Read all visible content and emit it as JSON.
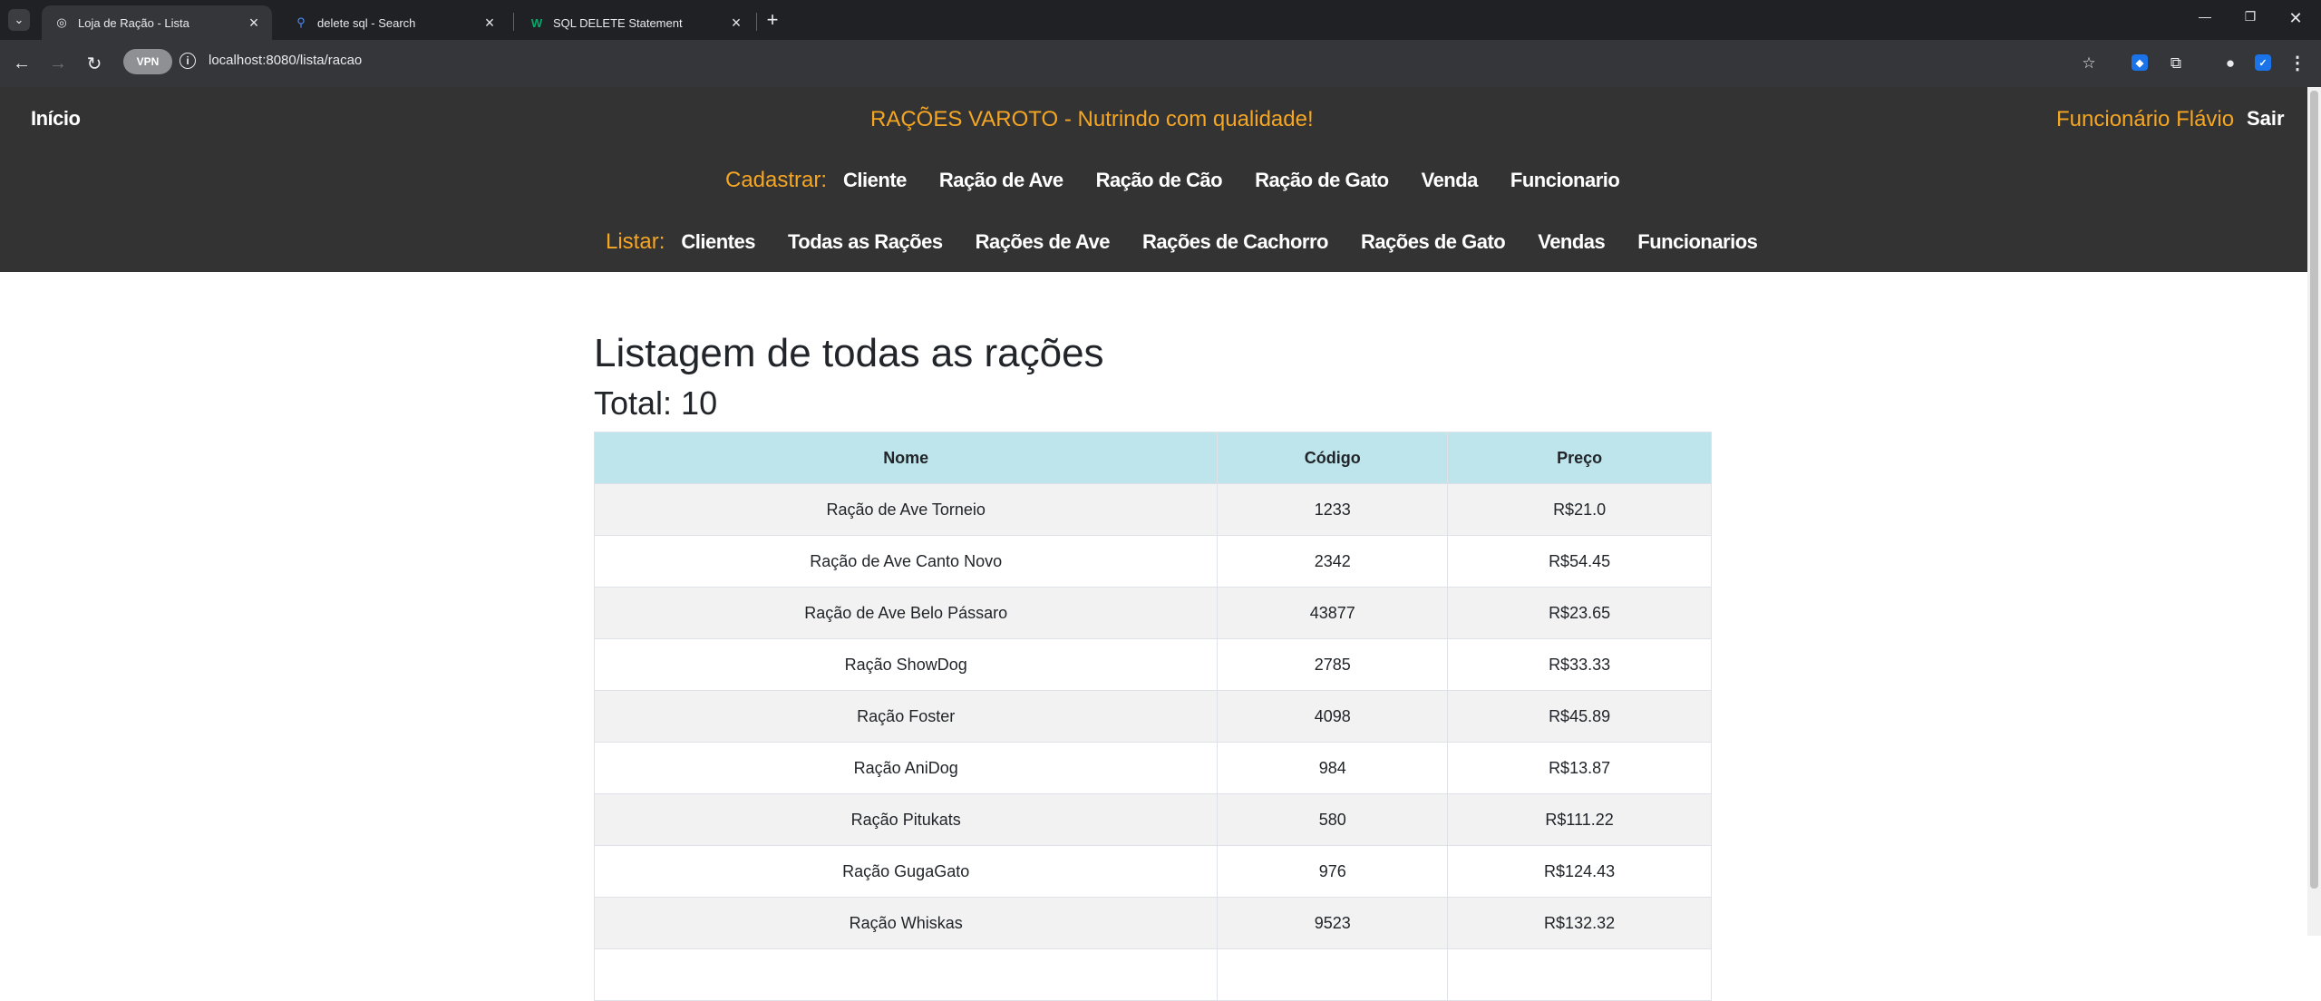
{
  "browser": {
    "tabs": [
      {
        "title": "Loja de Ração - Lista",
        "active": true
      },
      {
        "title": "delete sql - Search",
        "active": false
      },
      {
        "title": "SQL DELETE Statement",
        "active": false
      }
    ],
    "vpn_label": "VPN",
    "url": "localhost:8080/lista/racao"
  },
  "header": {
    "home": "Início",
    "brand": "RAÇÕES VAROTO - Nutrindo com qualidade!",
    "user": "Funcionário Flávio",
    "logout": "Sair",
    "register": {
      "label": "Cadastrar:",
      "items": [
        "Cliente",
        "Ração de Ave",
        "Ração de Cão",
        "Ração de Gato",
        "Venda",
        "Funcionario"
      ]
    },
    "list": {
      "label": "Listar:",
      "items": [
        "Clientes",
        "Todas as Rações",
        "Rações de Ave",
        "Rações de Cachorro",
        "Rações de Gato",
        "Vendas",
        "Funcionarios"
      ]
    }
  },
  "main": {
    "title": "Listagem de todas as rações",
    "total_label": "Total:",
    "total_value": "10",
    "table": {
      "columns": [
        "Nome",
        "Código",
        "Preço"
      ],
      "rows": [
        [
          "Ração de Ave Torneio",
          "1233",
          "R$21.0"
        ],
        [
          "Ração de Ave Canto Novo",
          "2342",
          "R$54.45"
        ],
        [
          "Ração de Ave Belo Pássaro",
          "43877",
          "R$23.65"
        ],
        [
          "Ração ShowDog",
          "2785",
          "R$33.33"
        ],
        [
          "Ração Foster",
          "4098",
          "R$45.89"
        ],
        [
          "Ração AniDog",
          "984",
          "R$13.87"
        ],
        [
          "Ração Pitukats",
          "580",
          "R$111.22"
        ],
        [
          "Ração GugaGato",
          "976",
          "R$124.43"
        ],
        [
          "Ração Whiskas",
          "9523",
          "R$132.32"
        ],
        [
          "",
          "",
          ""
        ]
      ]
    }
  },
  "colors": {
    "header_bg": "#333333",
    "accent": "#f5a623",
    "table_head_bg": "#bee5eb"
  }
}
